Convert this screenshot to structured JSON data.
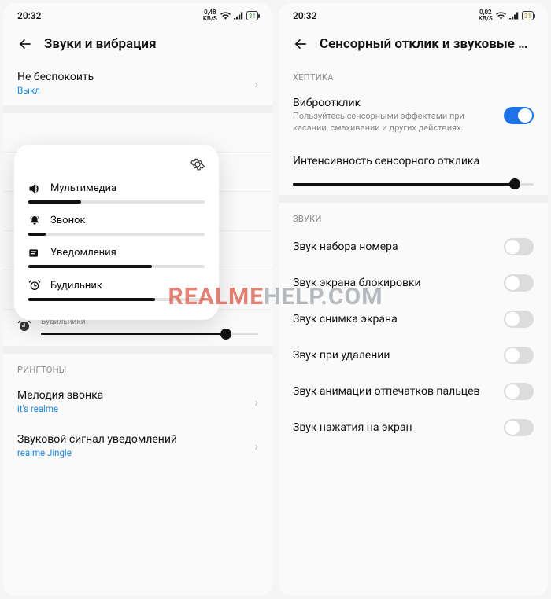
{
  "watermark": {
    "pre": "REALME",
    "suf": "HELP.COM"
  },
  "left": {
    "status": {
      "time": "20:32",
      "rate": "0,48",
      "rate_unit": "KB/S",
      "battery": "31"
    },
    "header": {
      "title": "Звуки и вибрация"
    },
    "dnd": {
      "title": "Не беспокоить",
      "sub": "Выкл"
    },
    "alarms": {
      "label": "Будильники",
      "percent": 85
    },
    "ringtones_section": "РИНГТОНЫ",
    "ringtone": {
      "title": "Мелодия звонка",
      "sub": "it's realme"
    },
    "notif": {
      "title": "Звуковой сигнал уведомлений",
      "sub": "realme Jingle"
    },
    "vol": {
      "multimedia": {
        "label": "Мультимедиа",
        "percent": 30
      },
      "ring": {
        "label": "Звонок",
        "percent": 10
      },
      "notify": {
        "label": "Уведомления",
        "percent": 70
      },
      "alarm": {
        "label": "Будильник",
        "percent": 72
      }
    }
  },
  "right": {
    "status": {
      "time": "20:32",
      "rate": "0,02",
      "rate_unit": "KB/S",
      "battery": "31"
    },
    "header": {
      "title": "Сенсорный отклик и звуковые сигна…"
    },
    "haptics_section": "ХЕПТИКА",
    "haptic": {
      "title": "Виброотклик",
      "desc": "Пользуйтесь сенсорными эффектами при касании, смахивании и других действиях.",
      "on": true
    },
    "intensity": {
      "title": "Интенсивность сенсорного отклика",
      "percent": 92
    },
    "sounds_section": "ЗВУКИ",
    "items": [
      {
        "label": "Звук набора номера",
        "on": false
      },
      {
        "label": "Звук экрана блокировки",
        "on": false
      },
      {
        "label": "Звук снимка экрана",
        "on": false
      },
      {
        "label": "Звук при удалении",
        "on": false
      },
      {
        "label": "Звук анимации отпечатков пальцев",
        "on": false
      },
      {
        "label": "Звук нажатия на экран",
        "on": false
      }
    ]
  }
}
